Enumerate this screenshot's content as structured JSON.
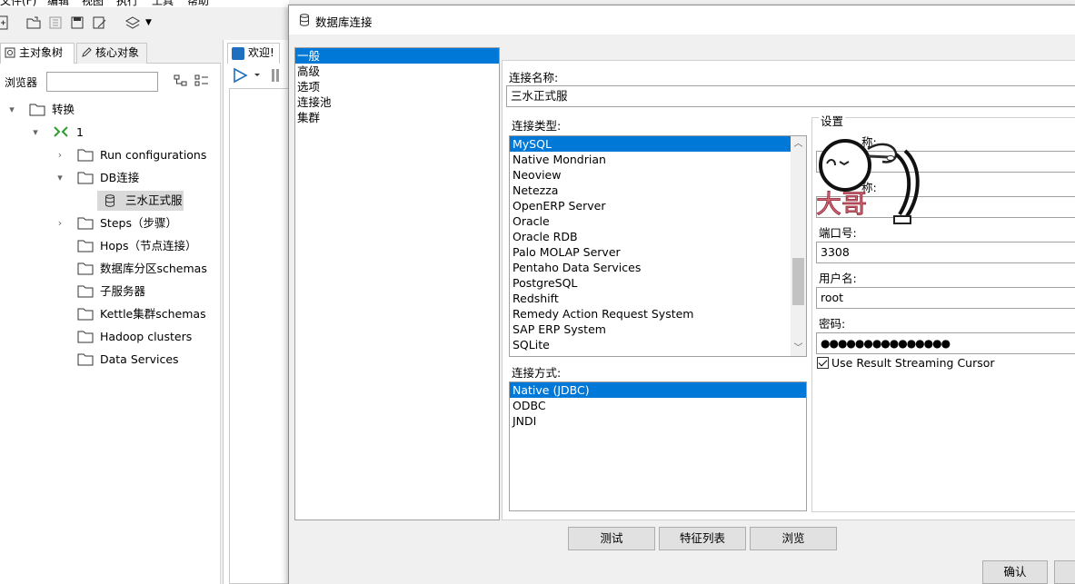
{
  "menubar": {
    "items": [
      "文件(F)",
      "编辑",
      "视图",
      "执行",
      "工具",
      "帮助"
    ]
  },
  "left_panel": {
    "tab_main": "主对象树",
    "tab_core": "核心对象",
    "browser_label": "浏览器",
    "browser_value": ""
  },
  "tree": {
    "root": "转换",
    "transform": "1",
    "items": [
      {
        "label": "Run configurations"
      },
      {
        "label": "DB连接"
      },
      {
        "label": "三水正式服"
      },
      {
        "label": "Steps（步骤）"
      },
      {
        "label": "Hops（节点连接）"
      },
      {
        "label": "数据库分区schemas"
      },
      {
        "label": "子服务器"
      },
      {
        "label": "Kettle集群schemas"
      },
      {
        "label": "Hadoop clusters"
      },
      {
        "label": "Data Services"
      }
    ]
  },
  "editor": {
    "welcome_tab": "欢迎!"
  },
  "dialog": {
    "title": "数据库连接",
    "categories": [
      "一般",
      "高级",
      "选项",
      "连接池",
      "集群"
    ],
    "selected_category": "一般",
    "connection_name_label": "连接名称:",
    "connection_name_value": "三水正式服",
    "connection_type_label": "连接类型:",
    "connection_types": [
      "MySQL",
      "Native Mondrian",
      "Neoview",
      "Netezza",
      "OpenERP Server",
      "Oracle",
      "Oracle RDB",
      "Palo MOLAP Server",
      "Pentaho Data Services",
      "PostgreSQL",
      "Redshift",
      "Remedy Action Request System",
      "SAP ERP System",
      "SQLite"
    ],
    "selected_type": "MySQL",
    "access_label": "连接方式:",
    "access_methods": [
      "Native (JDBC)",
      "ODBC",
      "JNDI"
    ],
    "selected_access": "Native (JDBC)",
    "settings_label": "设置",
    "partial_label_1": "称:",
    "partial_label_2": "称:",
    "port_label": "端口号:",
    "port_value": "3308",
    "username_label": "用户名:",
    "username_value": "root",
    "password_label": "密码:",
    "password_value": "●●●●●●●●●●●●●●●",
    "streaming_label": "Use Result Streaming Cursor",
    "streaming_checked": true,
    "btn_test": "测试",
    "btn_features": "特征列表",
    "btn_browse": "浏览",
    "btn_ok": "确认"
  },
  "watermark_text": "大哥",
  "colors": {
    "selection": "#0078d7",
    "dialog_bg": "#f0f0f0",
    "button_bg": "#e1e1e1",
    "kettle_green": "#2e9e2e"
  }
}
